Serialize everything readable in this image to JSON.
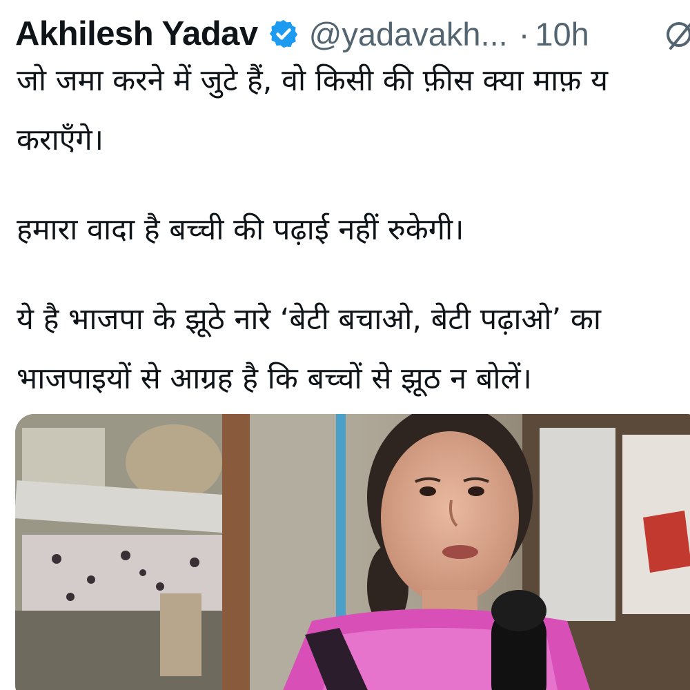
{
  "tweet": {
    "author_name": "Akhilesh Yadav",
    "handle": "@yadavakh...",
    "separator": "·",
    "time": "10h",
    "verified_icon": "verified-badge-icon",
    "grok_icon": "grok-icon",
    "paragraphs": [
      [
        "जो जमा करने में जुटे हैं, वो किसी की फ़ीस क्या माफ़ य",
        "कराएँगे।"
      ],
      [
        "हमारा वादा है बच्ची की पढ़ाई नहीं रुकेगी।"
      ],
      [
        "ये है भाजपा के झूठे नारे ‘बेटी बचाओ, बेटी पढ़ाओ’ का",
        "भाजपाइयों से आग्रह है कि बच्चों से झूठ न बोलें।"
      ]
    ],
    "media": {
      "type": "video-thumbnail",
      "description_icon": "girl-speaking-into-microphone-image"
    }
  },
  "colors": {
    "text": "#0f1419",
    "secondary": "#536471",
    "verified": "#1d9bf0"
  }
}
